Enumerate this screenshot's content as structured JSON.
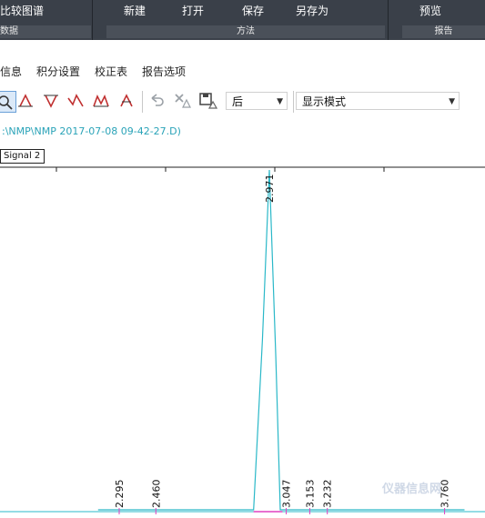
{
  "ribbon": {
    "compare_chromatogram": "比较图谱",
    "new": "新建",
    "open": "打开",
    "save": "保存",
    "save_as": "另存为",
    "preview": "预览",
    "group_data": "数据",
    "group_method": "方法",
    "group_report": "报告"
  },
  "menu_tabs": [
    "信息",
    "积分设置",
    "校正表",
    "报告选项"
  ],
  "toolbar": {
    "position_value": "后",
    "display_mode": "显示模式"
  },
  "file_path": ":\\NMP\\NMP 2017-07-08 09-42-27.D)",
  "signal_tab": "Signal 2",
  "chart_data": {
    "type": "line",
    "series": [
      {
        "values": [
          {
            "x": 2.2,
            "y": 0
          },
          {
            "x": 2.9,
            "y": 0
          },
          {
            "x": 2.94,
            "y": 0.5
          },
          {
            "x": 2.971,
            "y": 1.0
          },
          {
            "x": 3.0,
            "y": 0.45
          },
          {
            "x": 3.02,
            "y": 0
          },
          {
            "x": 3.85,
            "y": 0
          }
        ]
      }
    ],
    "peak_labels": [
      "2.971",
      "2.295",
      "2.460",
      "3.047",
      "3.153",
      "3.232",
      "3.760"
    ],
    "colors": {
      "trace": "#2ab8c8",
      "baseline": "#e040c0"
    }
  },
  "watermark": "仪器信息网"
}
